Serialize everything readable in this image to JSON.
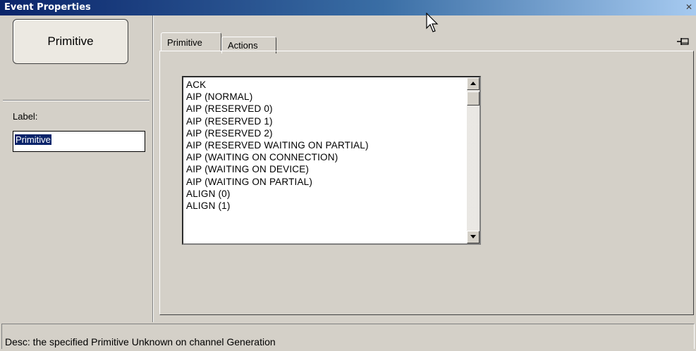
{
  "window": {
    "title": "Event Properties",
    "close_glyph": "✕"
  },
  "left_panel": {
    "primitive_button_label": "Primitive",
    "label_caption": "Label:",
    "label_value": "Primitive"
  },
  "tabs": [
    {
      "label": "Primitive",
      "active": true
    },
    {
      "label": "Actions",
      "active": false
    }
  ],
  "pin_icon": "pin-icon",
  "listbox": {
    "items": [
      "ACK",
      "AIP (NORMAL)",
      "AIP (RESERVED 0)",
      "AIP (RESERVED 1)",
      "AIP (RESERVED 2)",
      "AIP (RESERVED WAITING ON PARTIAL)",
      "AIP (WAITING ON CONNECTION)",
      "AIP (WAITING ON DEVICE)",
      "AIP (WAITING ON PARTIAL)",
      "ALIGN (0)",
      "ALIGN (1)"
    ]
  },
  "status": {
    "text": "Desc: the specified Primitive Unknown on channel Generation"
  },
  "colors": {
    "titlebar_start": "#0a246a",
    "titlebar_end": "#a6caf0",
    "face": "#d4d0c8",
    "selection": "#0a246a"
  }
}
